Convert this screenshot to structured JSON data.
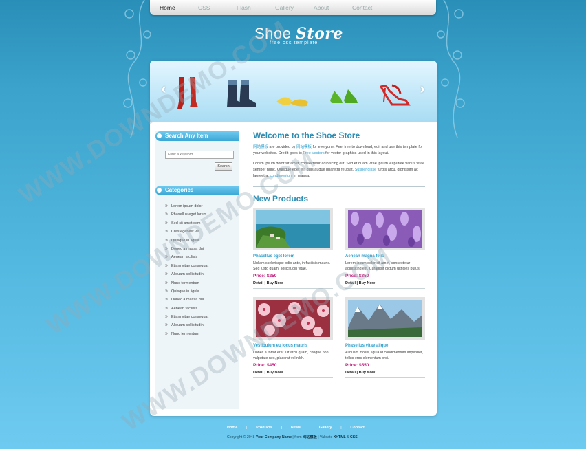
{
  "topnav": {
    "items": [
      {
        "label": "Home",
        "active": true
      },
      {
        "label": "CSS",
        "active": false
      },
      {
        "label": "Flash",
        "active": false
      },
      {
        "label": "Gallery",
        "active": false
      },
      {
        "label": "About",
        "active": false
      },
      {
        "label": "Contact",
        "active": false
      }
    ]
  },
  "logo": {
    "word1": "Shoe",
    "word2": "Store",
    "tagline": "free css template"
  },
  "banner": {
    "prev_icon": "chevron-left-icon",
    "next_icon": "chevron-right-icon"
  },
  "sidebar": {
    "search": {
      "title": "Search Any Item",
      "placeholder": "Enter a keyword...",
      "button": "Search"
    },
    "categories": {
      "title": "Categories",
      "items": [
        "Lorem ipsum dolor",
        "Phasellus eget lorem",
        "Sed sit amet sem",
        "Cras eget est vel",
        "Quisque in ligula",
        "Donec a massa dui",
        "Aenean facilisis",
        "Etiam vitae consequat",
        "Aliquam sollicitudin",
        "Nunc fermentum",
        "Quisque in ligula",
        "Donec a massa dui",
        "Aenean facilisis",
        "Etiam vitae consequat",
        "Aliquam sollicitudin",
        "Nunc fermentum"
      ]
    }
  },
  "content": {
    "welcome_title": "Welcome to the Shoe Store",
    "intro_p1_a": "网站模板",
    "intro_p1_b": " are provided by ",
    "intro_p1_link": "网站模板",
    "intro_p1_c": " for everyone. Feel free to download, edit and use this template for your websites. Credit goes to ",
    "intro_p1_link2": "Free Vectors",
    "intro_p1_d": " for vector graphics used in this layout.",
    "intro_p2_a": "Lorem ipsum dolor sit amet, consectetur adipiscing elit. Sed et quam vitae ipsum vulputate varius vitae semper nunc. Quisque eget elit quis augue pharetra feugiat. ",
    "intro_p2_link": "Suspendisse",
    "intro_p2_b": " turpis arcu, dignissim ac laoreet a, ",
    "intro_p2_link2": "condimentum",
    "intro_p2_c": " in massa.",
    "new_products_title": "New Products",
    "products": [
      {
        "title": "Phasellus eget lorem",
        "desc": "Nullam scelerisque odio ante, in facilisis mauris. Sed justo quam, sollicitudin vitae.",
        "price": "Price: $250",
        "detail": "Detail",
        "sep": " | ",
        "buy": "Buy Now"
      },
      {
        "title": "Aenean magna felis",
        "desc": "Lorem ipsum dolor sit amet, consectetur adipiscing elit. Curabitur dictum ultricies purus.",
        "price": "Price: $350",
        "detail": "Detail",
        "sep": " | ",
        "buy": "Buy Now"
      },
      {
        "title": "Vestibulum eu locus mauris",
        "desc": "Donec a tortor erat. Ut arcu quam, congue non vulputate nec, placerat vel nibh.",
        "price": "Price: $450",
        "detail": "Detail",
        "sep": " | ",
        "buy": "Buy Now"
      },
      {
        "title": "Phasellus vitae alique",
        "desc": "Aliquam mollis, ligula id condimentum imperdiet, tellus eros elementum orci.",
        "price": "Price: $550",
        "detail": "Detail",
        "sep": " | ",
        "buy": "Buy Now"
      }
    ]
  },
  "footer": {
    "nav": [
      "Home",
      "Products",
      "News",
      "Gallery",
      "Contact"
    ],
    "copy_a": "Copyright © 2048 ",
    "copy_company": "Your Company Name",
    "copy_b": " | from ",
    "copy_from": "网站模板",
    "copy_c": " | Validate ",
    "copy_xhtml": "XHTML",
    "copy_d": " & ",
    "copy_css": "CSS"
  },
  "watermark": "WWW.DOWNDEMO.COM",
  "colors": {
    "accent": "#2d8db3",
    "price": "#c0187c",
    "link": "#2d9fcc"
  }
}
